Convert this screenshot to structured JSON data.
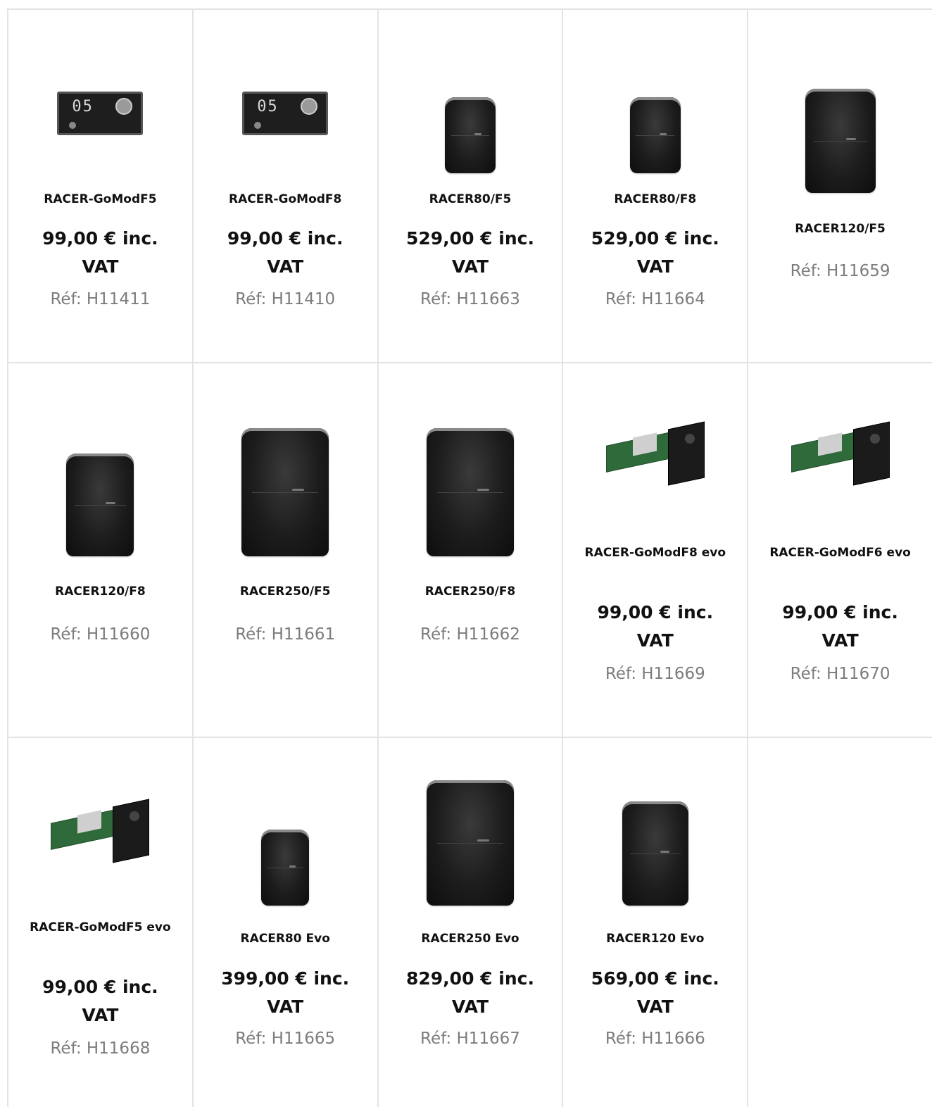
{
  "products": [
    {
      "name": "RACER-GoModF5",
      "price": "99,00 € inc. VAT",
      "ref": "Réf: H11411",
      "image": "receiver-image"
    },
    {
      "name": "RACER-GoModF8",
      "price": "99,00 € inc. VAT",
      "ref": "Réf: H11410",
      "image": "receiver-image"
    },
    {
      "name": "RACER80/F5",
      "price": "529,00 € inc. VAT",
      "ref": "Réf: H11663",
      "image": "speaker-image"
    },
    {
      "name": "RACER80/F8",
      "price": "529,00 € inc. VAT",
      "ref": "Réf: H11664",
      "image": "speaker-image"
    },
    {
      "name": "RACER120/F5",
      "price": "",
      "ref": "Réf: H11659",
      "image": "speaker-image"
    },
    {
      "name": "RACER120/F8",
      "price": "",
      "ref": "Réf: H11660",
      "image": "speaker-image"
    },
    {
      "name": "RACER250/F5",
      "price": "",
      "ref": "Réf: H11661",
      "image": "speaker-image"
    },
    {
      "name": "RACER250/F8",
      "price": "",
      "ref": "Réf: H11662",
      "image": "speaker-image"
    },
    {
      "name": "RACER-GoModF8 evo",
      "price": "99,00 € inc. VAT",
      "ref": "Réf: H11669",
      "image": "module-image"
    },
    {
      "name": "RACER-GoModF6 evo",
      "price": "99,00 € inc. VAT",
      "ref": "Réf: H11670",
      "image": "module-image"
    },
    {
      "name": "RACER-GoModF5 evo",
      "price": "99,00 € inc. VAT",
      "ref": "Réf: H11668",
      "image": "module-image"
    },
    {
      "name": "RACER80 Evo",
      "price": "399,00 € inc. VAT",
      "ref": "Réf: H11665",
      "image": "speaker-image"
    },
    {
      "name": "RACER250 Evo",
      "price": "829,00 € inc. VAT",
      "ref": "Réf: H11667",
      "image": "speaker-image"
    },
    {
      "name": "RACER120 Evo",
      "price": "569,00 € inc. VAT",
      "ref": "Réf: H11666",
      "image": "speaker-image"
    }
  ],
  "receiver_display": "05"
}
